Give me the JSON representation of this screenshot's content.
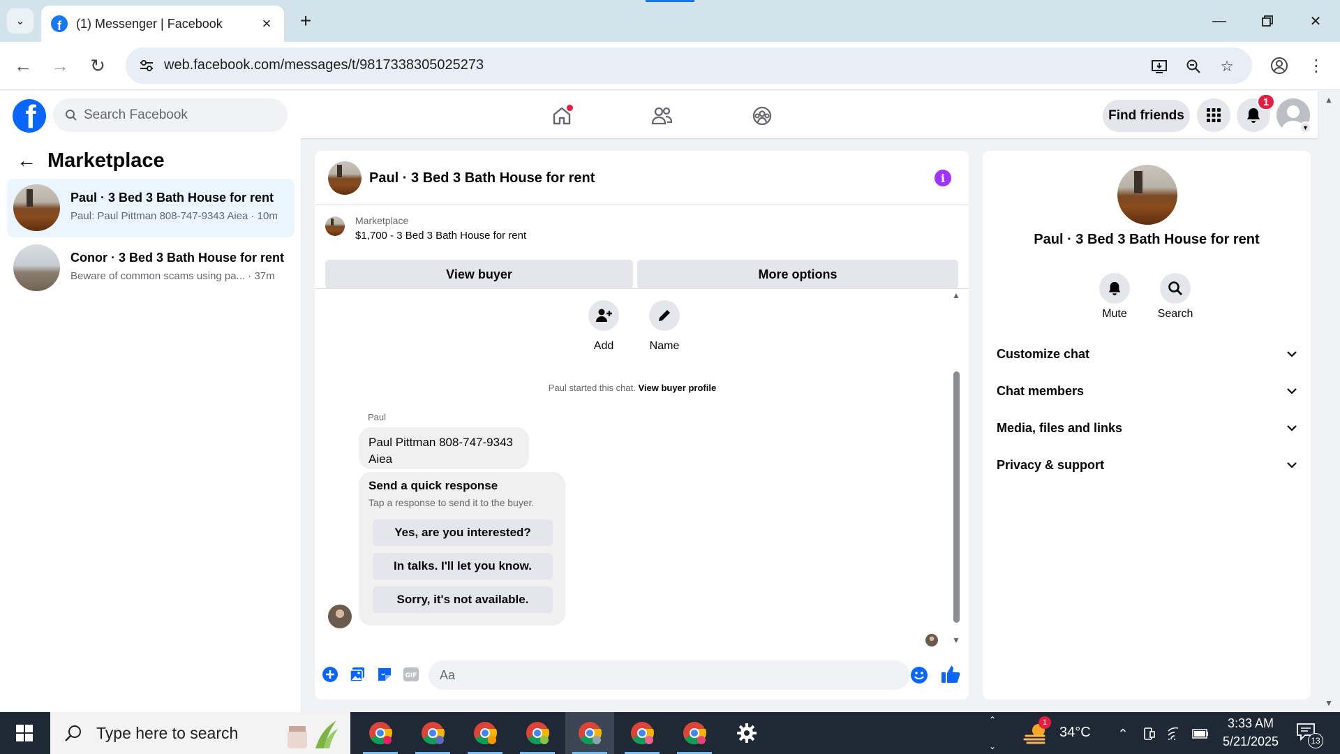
{
  "browser": {
    "tab_title": "(1) Messenger | Facebook",
    "url": "web.facebook.com/messages/t/9817338305025273"
  },
  "fb_header": {
    "search_placeholder": "Search Facebook",
    "find_friends": "Find friends",
    "notification_count": "1"
  },
  "sidebar": {
    "title": "Marketplace",
    "conversations": [
      {
        "title": "Paul · 3 Bed 3 Bath House for rent",
        "subtitle": "Paul: Paul Pittman 808-747-9343 Aiea · 10m",
        "active": true
      },
      {
        "title": "Conor · 3 Bed 3 Bath House for rent",
        "subtitle": "Beware of common scams using pa...  · 37m",
        "active": false
      }
    ]
  },
  "chat": {
    "title": "Paul · 3 Bed 3 Bath House for rent",
    "listing_source": "Marketplace",
    "listing_price_title": "$1,700 - 3 Bed 3 Bath House for rent",
    "view_buyer": "View buyer",
    "more_options": "More options",
    "actions": [
      {
        "label": "Add",
        "icon": "add-person-icon"
      },
      {
        "label": "Name",
        "icon": "pencil-icon"
      }
    ],
    "started_text": "Paul started this chat.",
    "started_link": "View buyer profile",
    "sender_name": "Paul",
    "message_line1": "Paul Pittman 808-747-9343",
    "message_line2": "Aiea",
    "quick_title": "Send a quick response",
    "quick_subtitle": "Tap a response to send it to the buyer.",
    "quick_responses": [
      "Yes, are you interested?",
      "In talks. I'll let you know.",
      "Sorry, it's not available."
    ],
    "composer_placeholder": "Aa"
  },
  "details": {
    "title": "Paul · 3 Bed 3 Bath House for rent",
    "actions": [
      {
        "label": "Mute",
        "icon": "bell-icon"
      },
      {
        "label": "Search",
        "icon": "search-icon"
      }
    ],
    "sections": [
      "Customize chat",
      "Chat members",
      "Media, files and links",
      "Privacy & support"
    ]
  },
  "taskbar": {
    "search_placeholder": "Type here to search",
    "weather_badge": "1",
    "temperature": "34°C",
    "time": "3:33 AM",
    "date": "5/21/2025",
    "notification_count": "13"
  },
  "colors": {
    "fb_blue": "#0866ff",
    "messenger_purple": "#a033ff",
    "taskbar_bg": "#1f2935"
  }
}
